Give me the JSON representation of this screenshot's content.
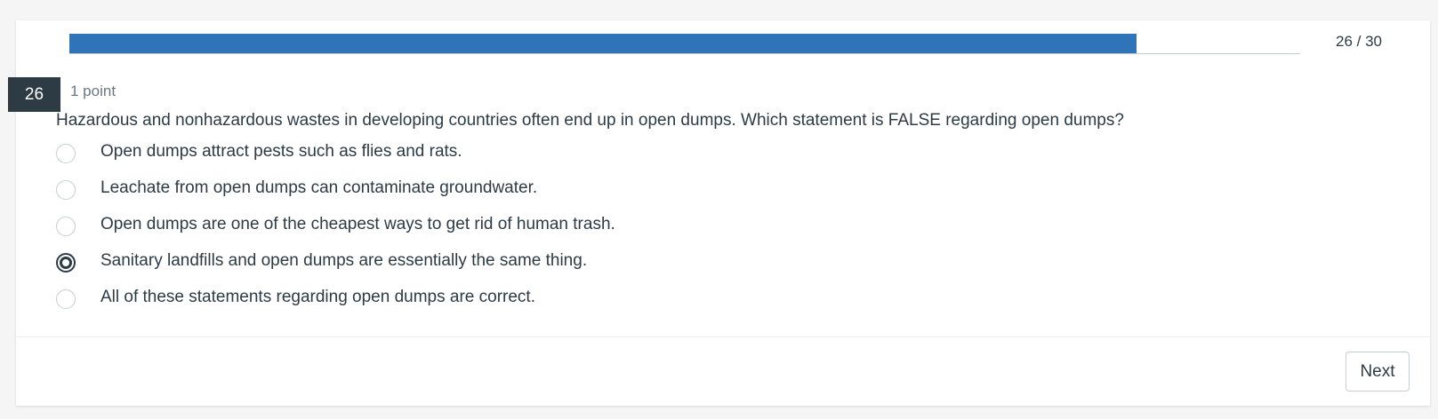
{
  "progress": {
    "current": 26,
    "total": 30,
    "fraction": 0.8667,
    "label": "26 / 30",
    "fill_color": "#2f74b9"
  },
  "question": {
    "number": "26",
    "points": "1 point",
    "text": "Hazardous and nonhazardous wastes in developing countries often end up in open dumps. Which statement is FALSE regarding open dumps?",
    "options": [
      {
        "label": "Open dumps attract pests such as flies and rats.",
        "selected": false
      },
      {
        "label": "Leachate from open dumps can contaminate groundwater.",
        "selected": false
      },
      {
        "label": "Open dumps are one of the cheapest ways to get rid of human trash.",
        "selected": false
      },
      {
        "label": "Sanitary landfills and open dumps are essentially the same thing.",
        "selected": true
      },
      {
        "label": "All of these statements regarding open dumps are correct.",
        "selected": false
      }
    ]
  },
  "footer": {
    "next_label": "Next"
  },
  "colors": {
    "header_badge": "#2d3b45",
    "text": "#2d3b45"
  }
}
